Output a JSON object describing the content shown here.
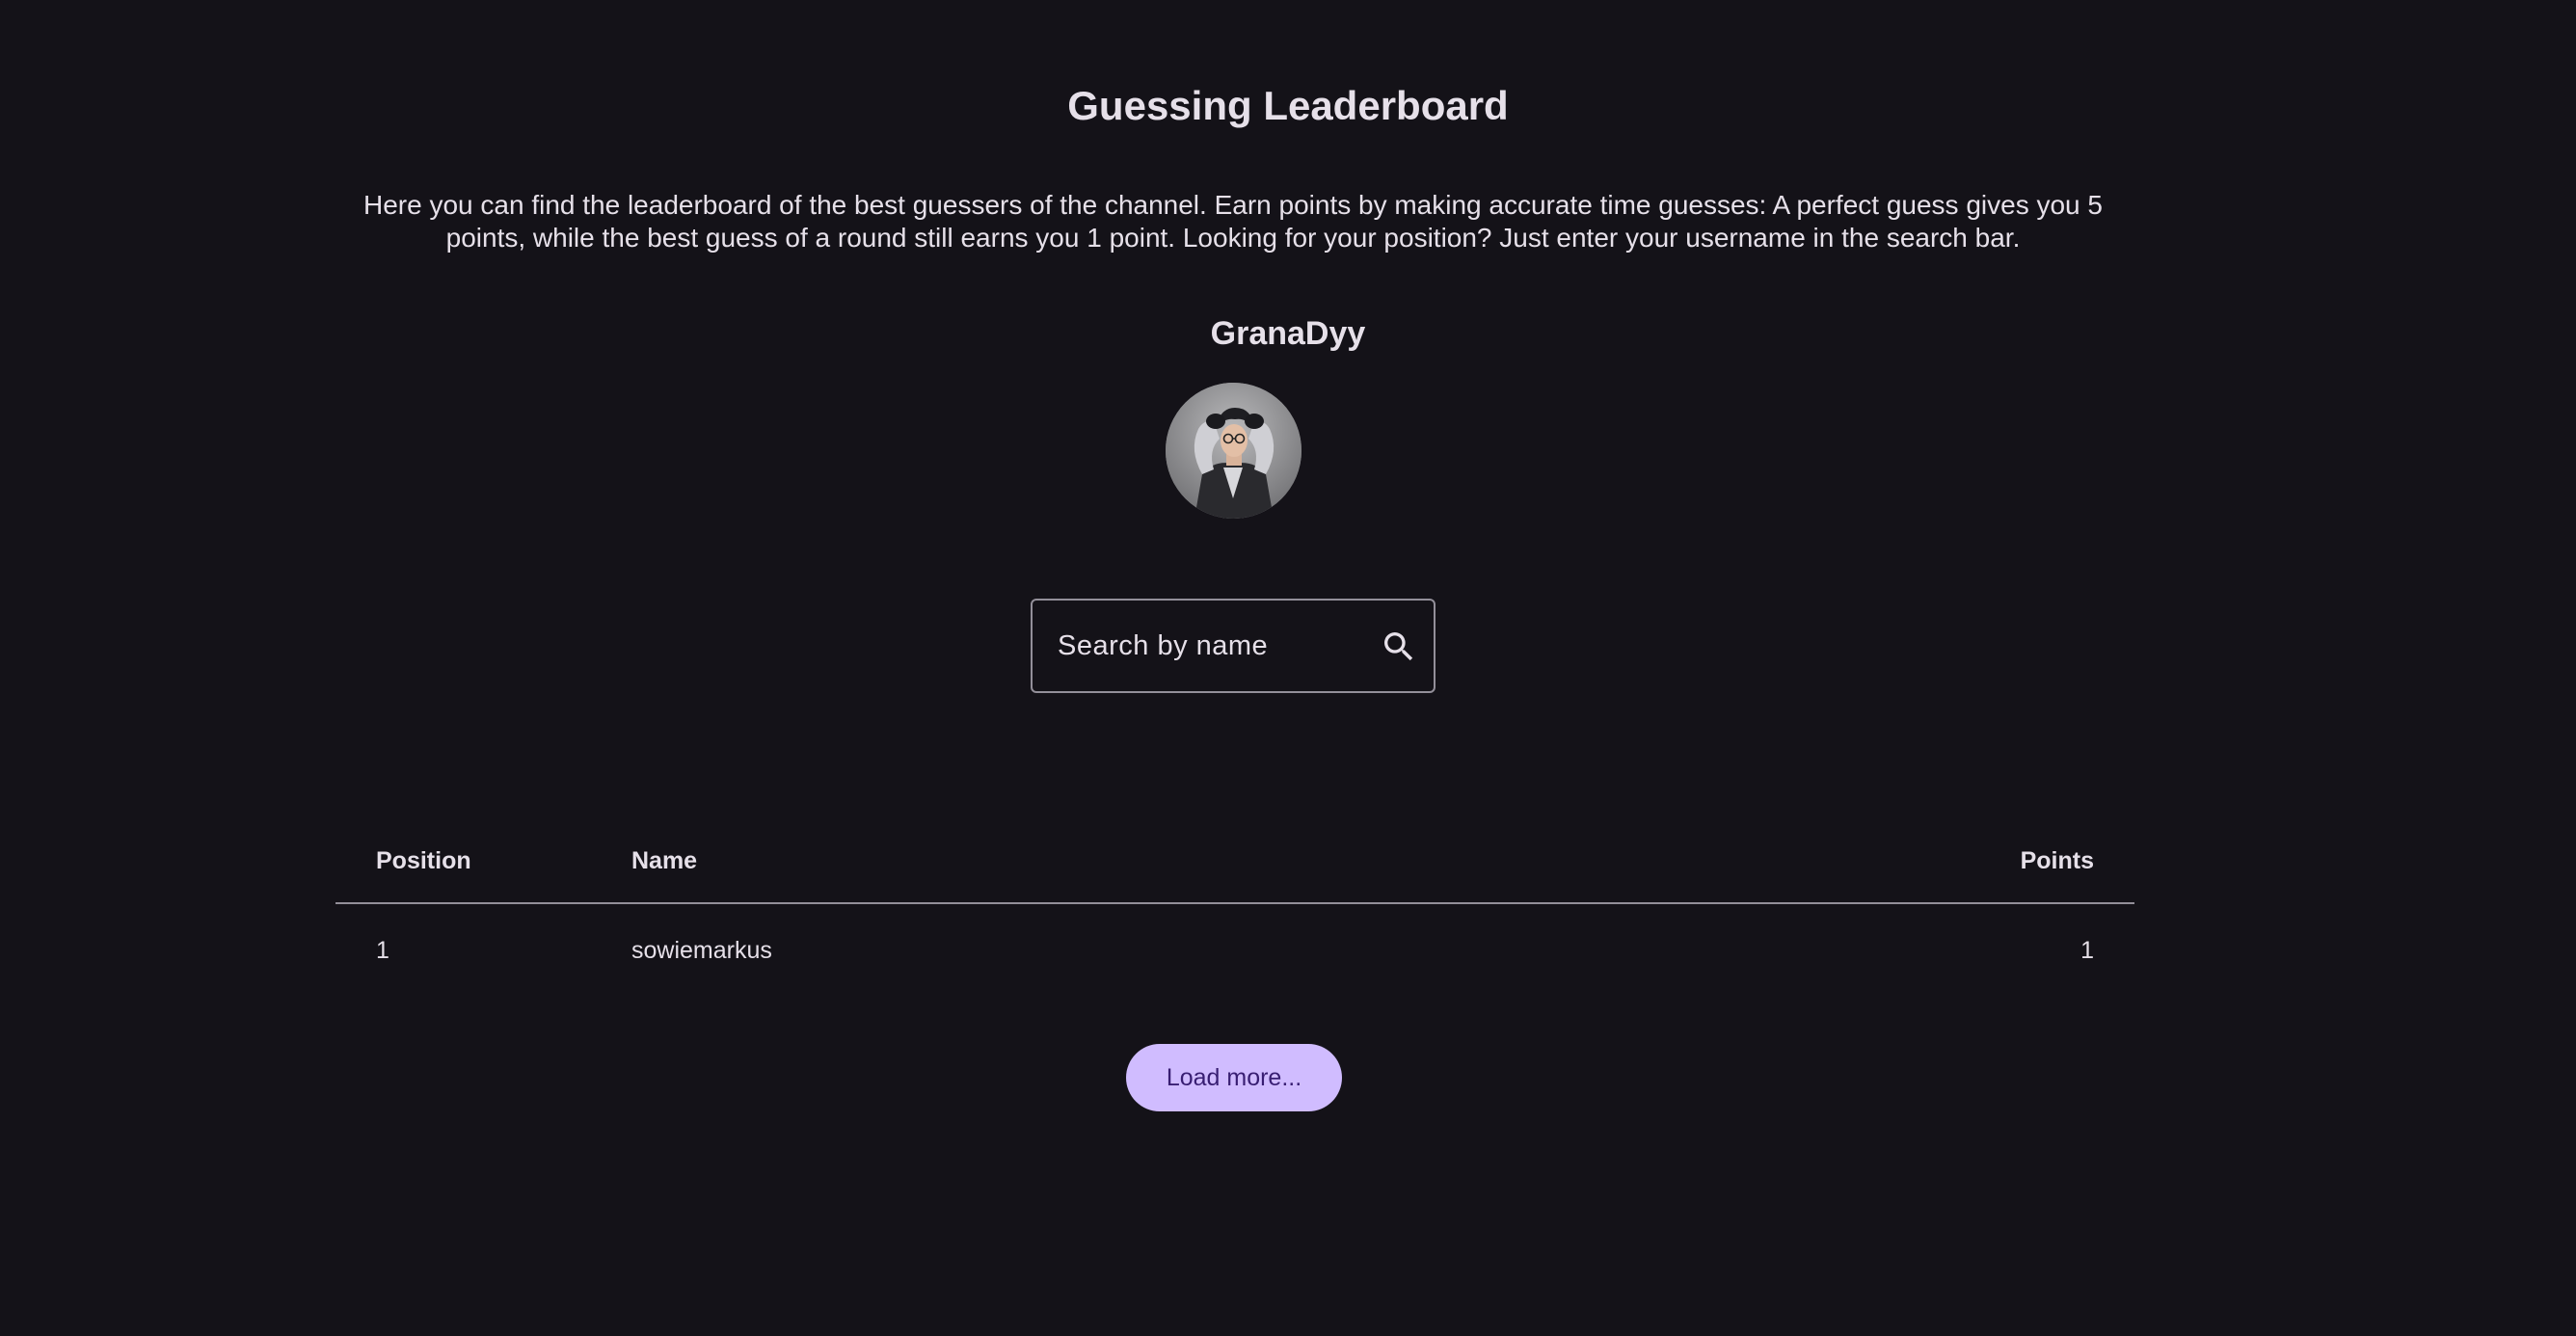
{
  "page": {
    "title": "Guessing Leaderboard",
    "description": "Here you can find the leaderboard of the best guessers of the channel. Earn points by making accurate time guesses: A perfect guess gives you 5 points, while the best guess of a round still earns you 1 point. Looking for your position? Just enter your username in the search bar."
  },
  "channel": {
    "name": "GranaDyy"
  },
  "search": {
    "placeholder": "Search by name",
    "value": "",
    "icon": "search-icon"
  },
  "table": {
    "headers": {
      "position": "Position",
      "name": "Name",
      "points": "Points"
    },
    "rows": [
      {
        "position": "1",
        "name": "sowiemarkus",
        "points": "1"
      }
    ]
  },
  "actions": {
    "load_more_label": "Load more..."
  },
  "colors": {
    "background": "#141218",
    "text": "#E6E0E9",
    "outline": "#938F99",
    "primary_container": "#D0BCFF",
    "on_primary_container": "#381E72"
  }
}
